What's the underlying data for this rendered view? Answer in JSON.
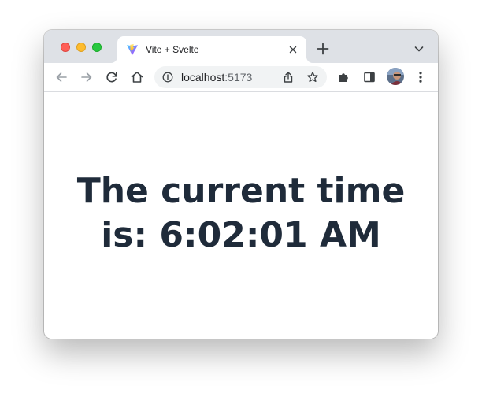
{
  "browser": {
    "tab": {
      "title": "Vite + Svelte",
      "favicon": "vite-logo-icon"
    },
    "omnibox": {
      "host": "localhost",
      "port": ":5173"
    },
    "icons": {
      "back": "arrow-left-icon",
      "forward": "arrow-right-icon",
      "reload": "reload-icon",
      "home": "home-icon",
      "info": "info-icon",
      "share": "share-icon",
      "bookmark": "star-icon",
      "extensions": "puzzle-icon",
      "side_panel": "side-panel-icon",
      "menu": "kebab-menu-icon",
      "new_tab": "plus-icon",
      "tab_search": "chevron-down-icon",
      "tab_close": "close-icon"
    },
    "colors": {
      "tabstrip": "#dee1e6",
      "close_light": "#fe5f57",
      "minimize_light": "#febc2e",
      "maximize_light": "#28c840"
    }
  },
  "page": {
    "time_line1": "The current time",
    "time_line2": "is: 6:02:01 AM",
    "text_color": "#1f2b3a"
  }
}
